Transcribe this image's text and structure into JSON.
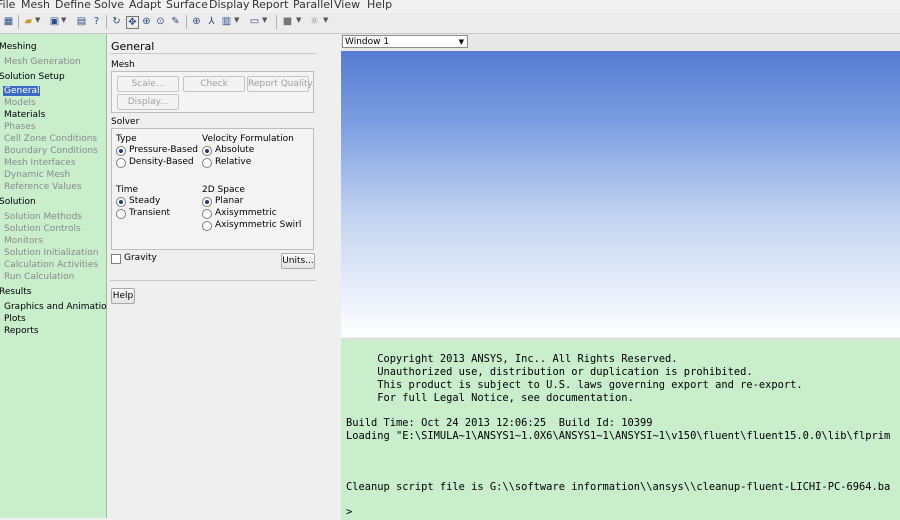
{
  "menubar": [
    "File",
    "Mesh",
    "Define",
    "Solve",
    "Adapt",
    "Surface",
    "Display",
    "Report",
    "Parallel",
    "View",
    "Help"
  ],
  "tree": {
    "sections": [
      {
        "label": "Meshing",
        "items": [
          {
            "label": "Mesh Generation",
            "state": "inactive"
          }
        ]
      },
      {
        "label": "Solution Setup",
        "items": [
          {
            "label": "General",
            "state": "selected"
          },
          {
            "label": "Models",
            "state": "inactive"
          },
          {
            "label": "Materials",
            "state": "active"
          },
          {
            "label": "Phases",
            "state": "inactive"
          },
          {
            "label": "Cell Zone Conditions",
            "state": "inactive"
          },
          {
            "label": "Boundary Conditions",
            "state": "inactive"
          },
          {
            "label": "Mesh Interfaces",
            "state": "inactive"
          },
          {
            "label": "Dynamic Mesh",
            "state": "inactive"
          },
          {
            "label": "Reference Values",
            "state": "inactive"
          }
        ]
      },
      {
        "label": "Solution",
        "items": [
          {
            "label": "Solution Methods",
            "state": "inactive"
          },
          {
            "label": "Solution Controls",
            "state": "inactive"
          },
          {
            "label": "Monitors",
            "state": "inactive"
          },
          {
            "label": "Solution Initialization",
            "state": "inactive"
          },
          {
            "label": "Calculation Activities",
            "state": "inactive"
          },
          {
            "label": "Run Calculation",
            "state": "inactive"
          }
        ]
      },
      {
        "label": "Results",
        "items": [
          {
            "label": "Graphics and Animations",
            "state": "active"
          },
          {
            "label": "Plots",
            "state": "active"
          },
          {
            "label": "Reports",
            "state": "active"
          }
        ]
      }
    ]
  },
  "general": {
    "title": "General",
    "mesh_label": "Mesh",
    "scale_btn": "Scale...",
    "check_btn": "Check",
    "report_quality_btn": "Report Quality",
    "display_btn": "Display...",
    "solver_label": "Solver",
    "type_label": "Type",
    "type_options": [
      "Pressure-Based",
      "Density-Based"
    ],
    "velocity_label": "Velocity Formulation",
    "velocity_options": [
      "Absolute",
      "Relative"
    ],
    "time_label": "Time",
    "time_options": [
      "Steady",
      "Transient"
    ],
    "space_label": "2D Space",
    "space_options": [
      "Planar",
      "Axisymmetric",
      "Axisymmetric Swirl"
    ],
    "gravity_label": "Gravity",
    "units_btn": "Units...",
    "help_btn": "Help",
    "selected": {
      "type": "Pressure-Based",
      "velocity": "Absolute",
      "time": "Steady",
      "space": "Planar"
    },
    "gravity_checked": false
  },
  "graphics": {
    "window_select": "Window 1"
  },
  "console": {
    "lines": [
      "     Copyright 2013 ANSYS, Inc.. All Rights Reserved.",
      "     Unauthorized use, distribution or duplication is prohibited.",
      "     This product is subject to U.S. laws governing export and re-export.",
      "     For full Legal Notice, see documentation.",
      "",
      "Build Time: Oct 24 2013 12:06:25  Build Id: 10399",
      "Loading \"E:\\SIMULA~1\\ANSYS1~1.0X6\\ANSYS1~1\\ANSYSI~1\\v150\\fluent\\fluent15.0.0\\lib\\flprim",
      "",
      "",
      "",
      "",
      "Cleanup script file is G:\\\\software information\\\\ansys\\\\cleanup-fluent-LICHI-PC-6964.ba",
      "",
      ">"
    ]
  }
}
